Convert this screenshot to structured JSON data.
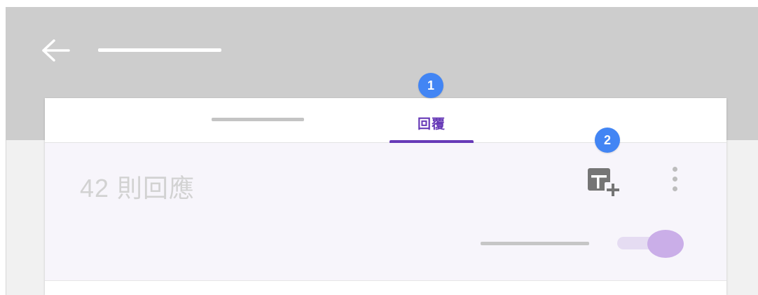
{
  "header": {
    "back_icon": "arrow-left-icon",
    "title": ""
  },
  "tabs": [
    {
      "id": "questions",
      "label": ""
    },
    {
      "id": "responses",
      "label": "回覆",
      "active": true
    }
  ],
  "responses_panel": {
    "count_text": "42 則回應",
    "sheet_icon": "spreadsheet-add-icon",
    "more_icon": "more-vert-icon",
    "accepting_label": "",
    "accepting_responses": true
  },
  "callouts": [
    {
      "number": "1"
    },
    {
      "number": "2"
    }
  ],
  "colors": {
    "accent": "#673ab7",
    "callout": "#4285f4",
    "topbar": "#cdcdcd",
    "panel": "#f7f5fb",
    "toggle_knob": "#caaee8",
    "toggle_track": "#e5dcf2"
  }
}
